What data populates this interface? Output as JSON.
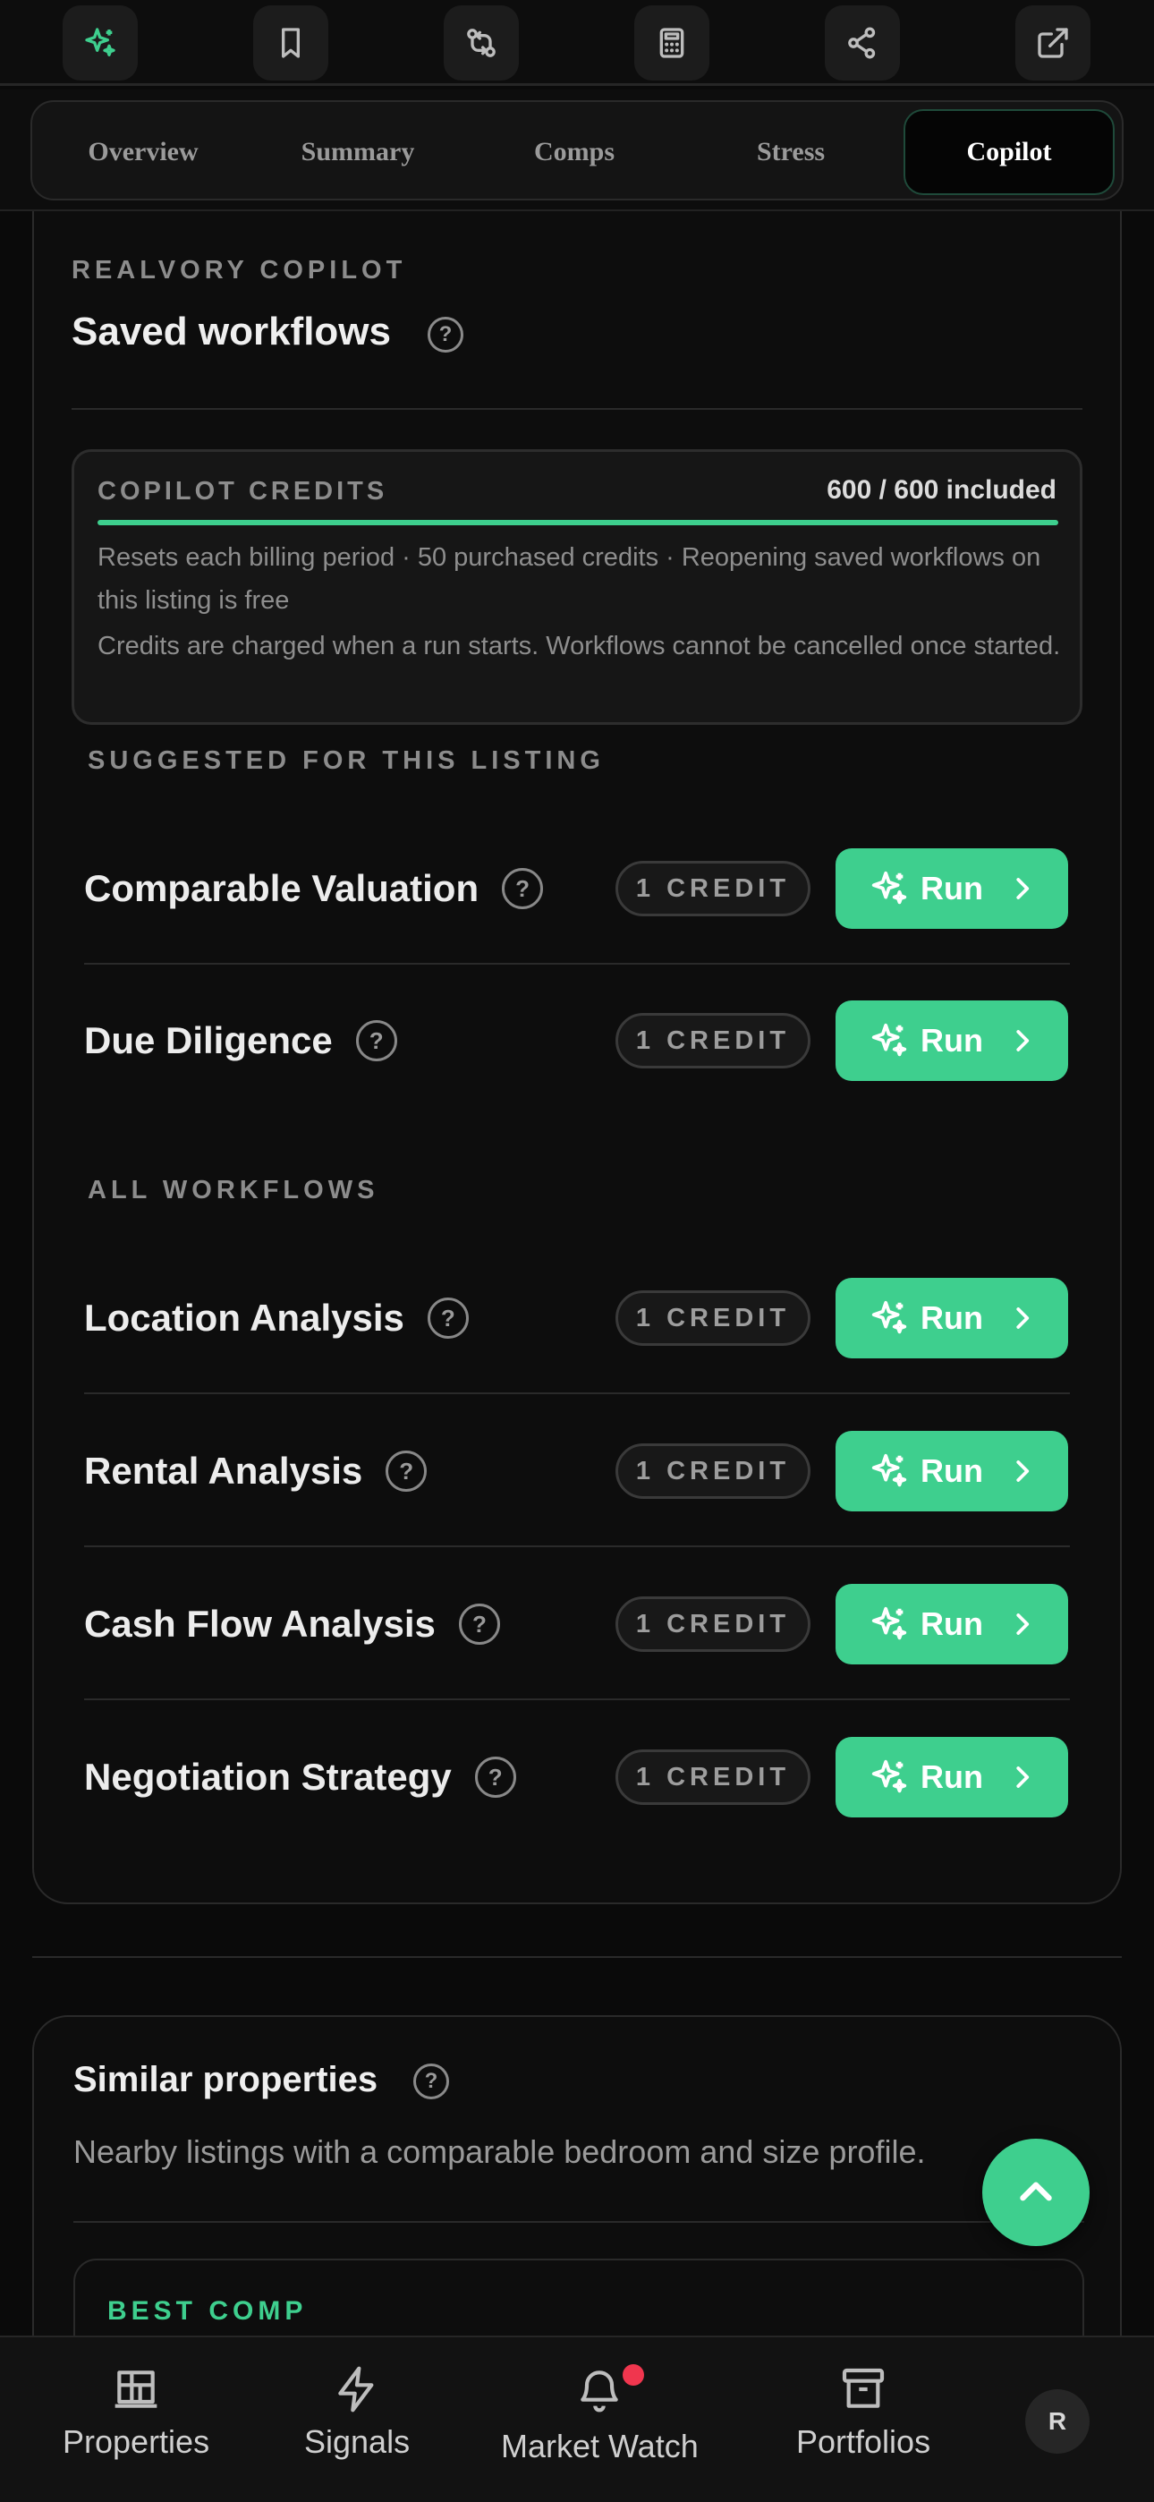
{
  "toolbar": {
    "icons": [
      "sparkles-icon",
      "bookmark-icon",
      "compare-icon",
      "calculator-icon",
      "share-icon",
      "external-link-icon"
    ]
  },
  "tabs": [
    {
      "label": "Overview",
      "active": false
    },
    {
      "label": "Summary",
      "active": false
    },
    {
      "label": "Comps",
      "active": false
    },
    {
      "label": "Stress",
      "active": false
    },
    {
      "label": "Copilot",
      "active": true
    }
  ],
  "copilot": {
    "eyebrow": "REALVORY COPILOT",
    "title": "Saved workflows",
    "help": "?",
    "credits": {
      "label": "COPILOT CREDITS",
      "value": "600 / 600 included",
      "used_fraction": 1.0,
      "note1": "Resets each billing period · 50 purchased credits · Reopening saved workflows on this listing is free",
      "note2": "Credits are charged when a run starts. Workflows cannot be cancelled once started."
    },
    "suggested_label": "SUGGESTED FOR THIS LISTING",
    "all_label": "ALL WORKFLOWS",
    "run_label": "Run",
    "credit_label": "1 CREDIT",
    "suggested": [
      "Comparable Valuation",
      "Due Diligence"
    ],
    "all": [
      "Location Analysis",
      "Rental Analysis",
      "Cash Flow Analysis",
      "Negotiation Strategy"
    ]
  },
  "similar": {
    "title": "Similar properties",
    "subtitle": "Nearby listings with a comparable bedroom and size profile.",
    "best_comp": "BEST COMP"
  },
  "bottom_nav": {
    "properties": "Properties",
    "signals": "Signals",
    "market_watch": "Market Watch",
    "portfolios": "Portfolios",
    "avatar_initial": "R"
  },
  "colors": {
    "accent": "#3ecf8e",
    "notification": "#f0364e",
    "background": "#0a0a0a"
  }
}
